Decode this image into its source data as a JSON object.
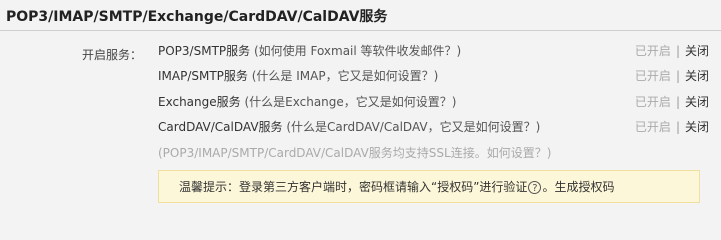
{
  "section": {
    "title": "POP3/IMAP/SMTP/Exchange/CardDAV/CalDAV服务"
  },
  "service_label": "开启服务：",
  "rows": [
    {
      "name": "POP3/SMTP服务",
      "help": "(如何使用 Foxmail 等软件收发邮件？)",
      "status_on": "已开启",
      "separator": "|",
      "action_off": "关闭"
    },
    {
      "name": "IMAP/SMTP服务",
      "help": "(什么是 IMAP，它又是如何设置？)",
      "status_on": "已开启",
      "separator": "|",
      "action_off": "关闭"
    },
    {
      "name": "Exchange服务",
      "help": "(什么是Exchange，它又是如何设置？)",
      "status_on": "已开启",
      "separator": "|",
      "action_off": "关闭"
    },
    {
      "name": "CardDAV/CalDAV服务",
      "help": "(什么是CardDAV/CalDAV，它又是如何设置？)",
      "status_on": "已开启",
      "separator": "|",
      "action_off": "关闭"
    }
  ],
  "ssl_note": "(POP3/IMAP/SMTP/CardDAV/CalDAV服务均支持SSL连接。如何设置？)",
  "tip": {
    "text_before": "温馨提示：登录第三方客户端时，密码框请输入“授权码”进行验证",
    "help_glyph": "?",
    "text_after": "。生成授权码"
  },
  "colors": {
    "background": "#f3f3f3",
    "tip_background": "#fdf7d9",
    "tip_border": "#f0e0a0",
    "muted": "#aaaaaa"
  }
}
